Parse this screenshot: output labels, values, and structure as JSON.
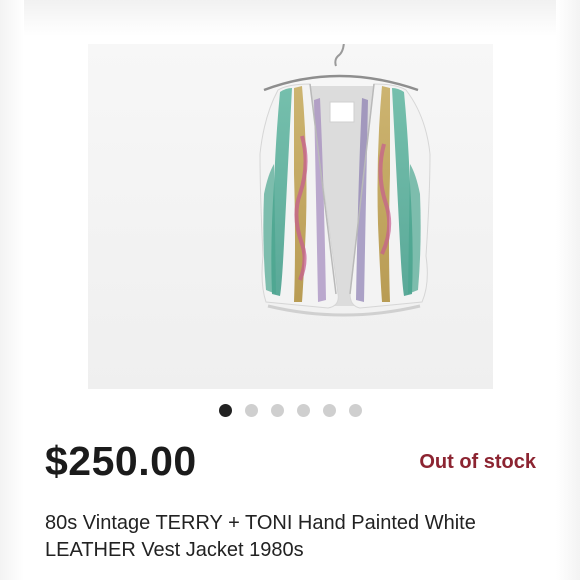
{
  "listing": {
    "price": "$250.00",
    "availability": "Out of stock",
    "title": "80s Vintage TERRY + TONI Hand Painted White LEATHER Vest Jacket 1980s"
  },
  "gallery": {
    "image_count": 6,
    "active_index": 0
  },
  "colors": {
    "price_text": "#1b1b1b",
    "out_of_stock": "#8c2431",
    "dot_active": "#222222",
    "dot_inactive": "#cfcfcf"
  }
}
